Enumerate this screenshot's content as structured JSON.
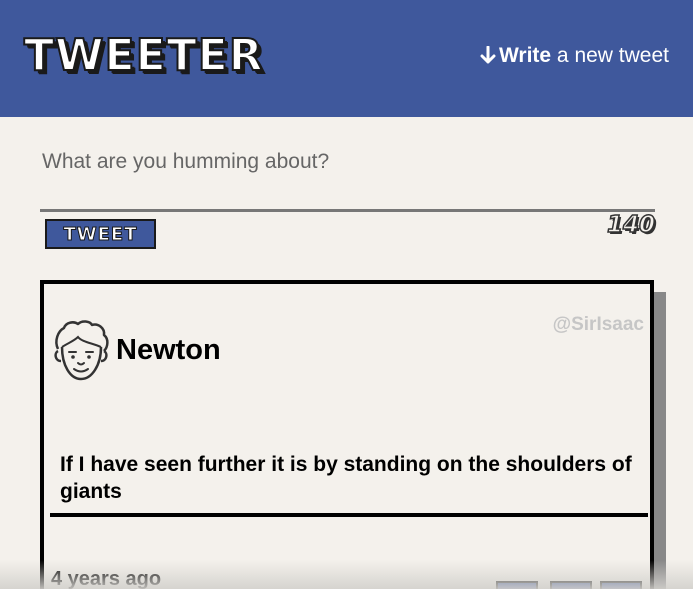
{
  "nav": {
    "logo": "TWEETER",
    "compose_bold": "Write",
    "compose_rest": " a new tweet",
    "compose_icon": "arrow-down-icon"
  },
  "composer": {
    "placeholder": "What are you humming about?",
    "value": "",
    "button_label": "TWEET",
    "counter": "140"
  },
  "tweets": [
    {
      "name": "Newton",
      "handle": "@SirIsaac",
      "avatar_icon": "avatar-face-icon",
      "content": "If I have seen further it is by standing on the shoulders of giants",
      "timestamp": "4 years ago",
      "actions": [
        "flag-icon",
        "retweet-icon",
        "like-icon"
      ]
    }
  ],
  "colors": {
    "brand": "#3f589c",
    "background": "#f4f1ec",
    "handle": "#c6c6c6"
  }
}
